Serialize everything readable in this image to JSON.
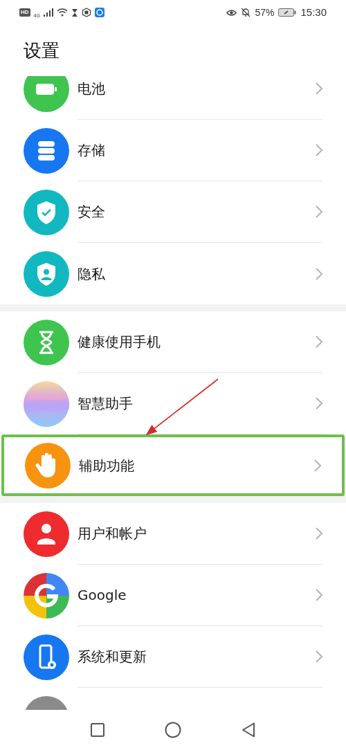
{
  "status_bar": {
    "hd": "HD",
    "network": "4G",
    "battery_percent": "57%",
    "time": "15:30"
  },
  "title": "设置",
  "groups": [
    {
      "items": [
        {
          "label": "电池",
          "kind": "battery",
          "color": "#3ec44f",
          "highlighted": false
        },
        {
          "label": "存储",
          "kind": "storage",
          "color": "#1677f0",
          "highlighted": false
        },
        {
          "label": "安全",
          "kind": "shield",
          "color": "#12b8c0",
          "highlighted": false
        },
        {
          "label": "隐私",
          "kind": "privacy",
          "color": "#12b8c0",
          "highlighted": false
        }
      ]
    },
    {
      "items": [
        {
          "label": "健康使用手机",
          "kind": "hourglass",
          "color": "#3ec44f",
          "highlighted": false
        },
        {
          "label": "智慧助手",
          "kind": "orb",
          "highlighted": false
        },
        {
          "label": "辅助功能",
          "kind": "hand",
          "color": "#f7930f",
          "highlighted": true
        }
      ]
    },
    {
      "items": [
        {
          "label": "用户和帐户",
          "kind": "user",
          "color": "#ee2b2f",
          "highlighted": false
        },
        {
          "label": "Google",
          "kind": "google",
          "highlighted": false
        },
        {
          "label": "系统和更新",
          "kind": "phone",
          "color": "#1677f0",
          "highlighted": false
        },
        {
          "kind": "partial",
          "color": "#8a8a8a",
          "highlighted": false
        }
      ]
    }
  ]
}
